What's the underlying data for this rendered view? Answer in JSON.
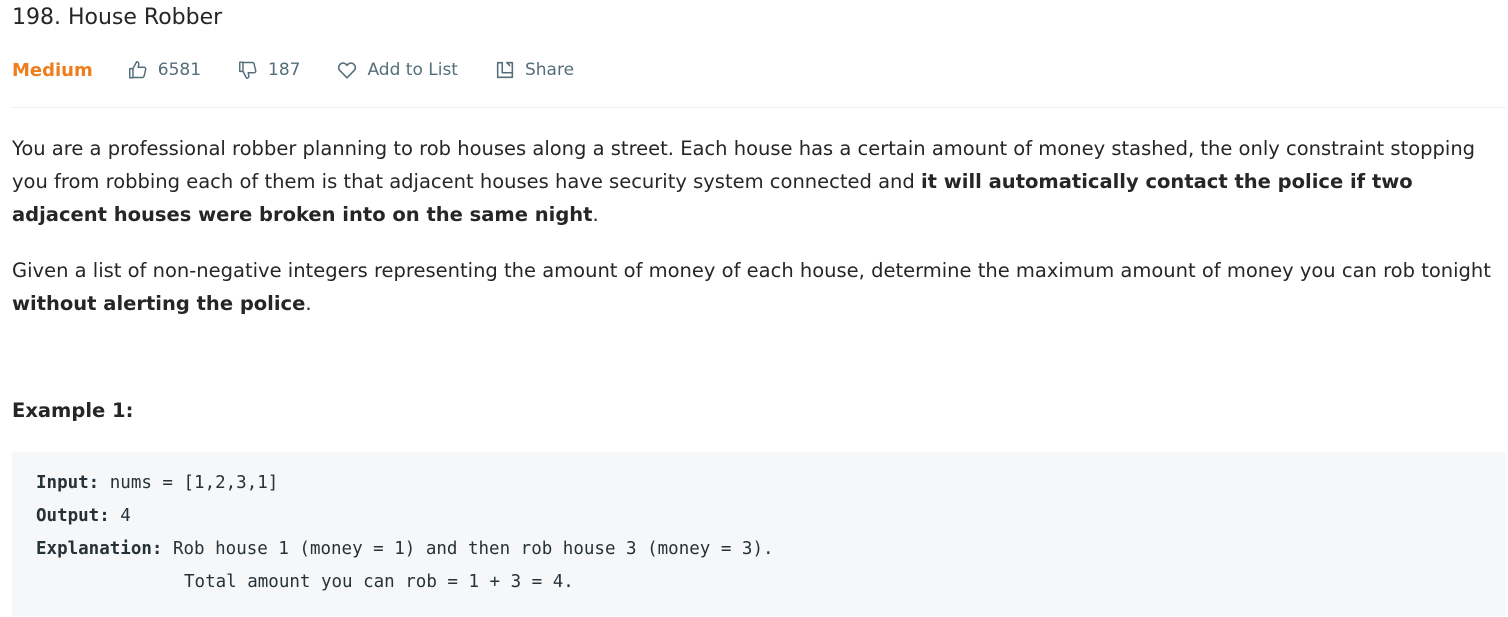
{
  "problem": {
    "title": "198. House Robber",
    "difficulty": "Medium",
    "likes": "6581",
    "dislikes": "187",
    "add_to_list_label": "Add to List",
    "share_label": "Share"
  },
  "description": {
    "p1_text": "You are a professional robber planning to rob houses along a street. Each house has a certain amount of money stashed, the only constraint stopping you from robbing each of them is that adjacent houses have security system connected and ",
    "p1_bold": "it will automatically contact the police if two adjacent houses were broken into on the same night",
    "p1_end": ".",
    "p2_text": "Given a list of non-negative integers representing the amount of money of each house, determine the maximum amount of money you can rob tonight ",
    "p2_bold": "without alerting the police",
    "p2_end": "."
  },
  "example": {
    "title": "Example 1:",
    "input_label": "Input:",
    "input_value": " nums = [1,2,3,1]",
    "output_label": "Output:",
    "output_value": " 4",
    "explanation_label": "Explanation:",
    "explanation_line1": " Rob house 1 (money = 1) and then rob house 3 (money = 3).",
    "explanation_line2": "Total amount you can rob = 1 + 3 = 4."
  },
  "colors": {
    "difficulty_medium": "#ef7d1b",
    "meta_text": "#546e7a",
    "code_background": "#f6f7f8"
  },
  "icons": {
    "like": "thumbs-up-icon",
    "dislike": "thumbs-down-icon",
    "add_to_list": "heart-icon",
    "share": "share-icon"
  }
}
